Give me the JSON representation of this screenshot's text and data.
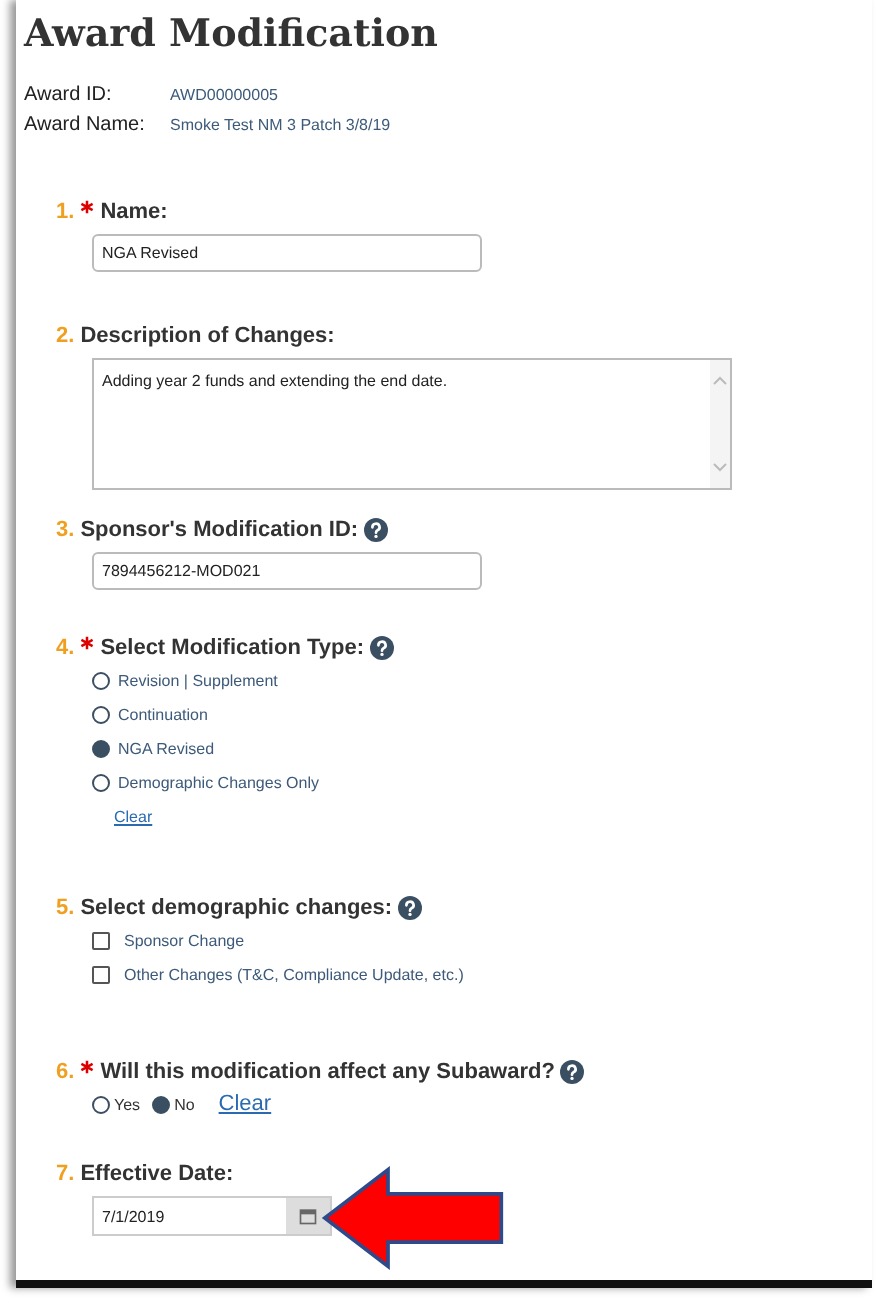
{
  "title": "Award Modification",
  "award_info": [
    {
      "label": "Award ID:",
      "value": "AWD00000005"
    },
    {
      "label": "Award Name:",
      "value": "Smoke Test NM 3 Patch 3/8/19"
    }
  ],
  "questions": [
    {
      "number": "1.",
      "required": true,
      "label": "Name:",
      "help": false,
      "kind": "text",
      "value": "NGA Revised"
    },
    {
      "number": "2.",
      "required": false,
      "label": "Description of Changes:",
      "help": false,
      "kind": "textarea",
      "value": "Adding year 2 funds and extending the end date."
    },
    {
      "number": "3.",
      "required": false,
      "label": "Sponsor's Modification ID:",
      "help": true,
      "kind": "text",
      "value": "7894456212-MOD021"
    },
    {
      "number": "4.",
      "required": true,
      "label": "Select Modification Type:",
      "help": true,
      "kind": "radio",
      "clear": "Clear",
      "options": [
        {
          "label": "Revision | Supplement",
          "selected": false
        },
        {
          "label": "Continuation",
          "selected": false
        },
        {
          "label": "NGA Revised",
          "selected": true
        },
        {
          "label": "Demographic Changes Only",
          "selected": false
        }
      ]
    },
    {
      "number": "5.",
      "required": false,
      "label": "Select demographic changes:",
      "help": true,
      "kind": "checkbox",
      "options": [
        {
          "label": "Sponsor Change",
          "checked": false
        },
        {
          "label": "Other Changes (T&C, Compliance Update, etc.)",
          "checked": false
        }
      ]
    },
    {
      "number": "6.",
      "required": true,
      "label": "Will this modification affect any Subaward?",
      "help": true,
      "kind": "inline-radio",
      "clear": "Clear",
      "options": [
        {
          "label": "Yes",
          "selected": false
        },
        {
          "label": "No",
          "selected": true
        }
      ]
    },
    {
      "number": "7.",
      "required": false,
      "label": "Effective Date:",
      "help": false,
      "kind": "date",
      "value": "7/1/2019"
    }
  ]
}
